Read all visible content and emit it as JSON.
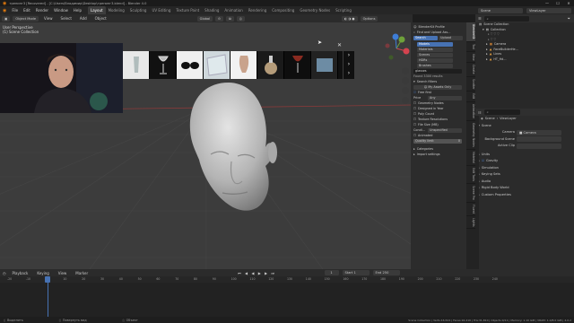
{
  "window": {
    "title": "тренинг3 [Recovered] - [C:\\Users\\Владимир\\Desktop\\тренинг3.blend] - Blender 4.0"
  },
  "menu": [
    "File",
    "Edit",
    "Render",
    "Window",
    "Help"
  ],
  "workspaces": [
    "Layout",
    "Modeling",
    "Sculpting",
    "UV Editing",
    "Texture Paint",
    "Shading",
    "Animation",
    "Rendering",
    "Compositing",
    "Geometry Nodes",
    "Scripting"
  ],
  "active_workspace": "Layout",
  "scene": {
    "label": "Scene",
    "viewlayer": "ViewLayer"
  },
  "viewport_header": {
    "mode": "Object Mode",
    "view": "View",
    "select": "Select",
    "add": "Add",
    "object": "Object",
    "orientation": "Global",
    "options": "Options"
  },
  "viewport_overlay": {
    "line1": "User Perspective",
    "line2": "(1) Scene Collection"
  },
  "asset_strip": {
    "thumbs": [
      "glass",
      "goblet",
      "sunglasses",
      "glass-pane",
      "vase",
      "flask",
      "wine-glass",
      "glass-tile"
    ]
  },
  "asset_panel": {
    "profile": "BlenderKit Profile",
    "find_upload": "Find and Upload Ass...",
    "search_tab": "Search",
    "upload_tab": "Upload",
    "categories": [
      "Models",
      "Materials",
      "Scenes",
      "HDRs",
      "Brushes"
    ],
    "query": "glasses",
    "found": "Found 3300 results",
    "search_filters": "Search filters",
    "my_assets": "My Assets Only",
    "free_first": "Free first",
    "price_label": "Price",
    "price_value": "Any",
    "filters": [
      "Geometry Nodes",
      "Designed in Year",
      "Poly Count",
      "Texture Resolutions",
      "File Size (MB)"
    ],
    "condition_label": "Condi...",
    "condition_value": "Unspecified",
    "animated": "Animated",
    "quality_limit": "Quality limit",
    "quality_value": "0",
    "categories_label": "Categories",
    "import_settings": "Import settings"
  },
  "sidebar_tabs": [
    "BlenderKit",
    "Tool",
    "View",
    "Create",
    "Scatter",
    "Edit",
    "Animation",
    "Geometry Nodes",
    "Material",
    "Edit Tools",
    "Scene Pro",
    "Fluent",
    "Lights"
  ],
  "outliner": {
    "root": "Scene Collection",
    "items": [
      "Collection",
      "Camera",
      "FaceBuilderHe...",
      "Lines",
      "HT_Hd..."
    ]
  },
  "properties": {
    "scene": "Scene",
    "viewlayer": "ViewLayer",
    "section": "Scene",
    "camera_label": "Camera",
    "camera_value": "Camera",
    "bg_scene": "Background Scene",
    "active_clip": "Active Clip",
    "units": "Units",
    "gravity": "Gravity",
    "simulation": "Simulation",
    "keying_sets": "Keying Sets",
    "audio": "Audio",
    "rigid_body": "Rigid Body World",
    "custom_props": "Custom Properties"
  },
  "timeline": {
    "playback": "Playback",
    "keying": "Keying",
    "view": "View",
    "marker": "Marker",
    "current_frame": "1",
    "start_label": "Start",
    "start": "1",
    "end_label": "End",
    "end": "250",
    "ticks": [
      "-20",
      "-10",
      "1",
      "10",
      "20",
      "30",
      "40",
      "50",
      "60",
      "70",
      "80",
      "90",
      "100",
      "110",
      "120",
      "130",
      "140",
      "150",
      "160",
      "170",
      "180",
      "190",
      "200",
      "210",
      "220",
      "230",
      "240"
    ]
  },
  "statusbar": {
    "left": "Выделить",
    "mid1": "Повернуть вид",
    "mid2": "Объект",
    "right": "Scene Collection | Verts:16,524 | Faces:16,416 | Tris:31,810 | Objects:0/11 | Memory: 1.10 GiB | VRAM: 1.0/8.0 GiB | 4.0.2"
  },
  "colors": {
    "accent": "#4772b3",
    "viewport": "#3c3c3c",
    "active_frame": "#4772b3"
  }
}
